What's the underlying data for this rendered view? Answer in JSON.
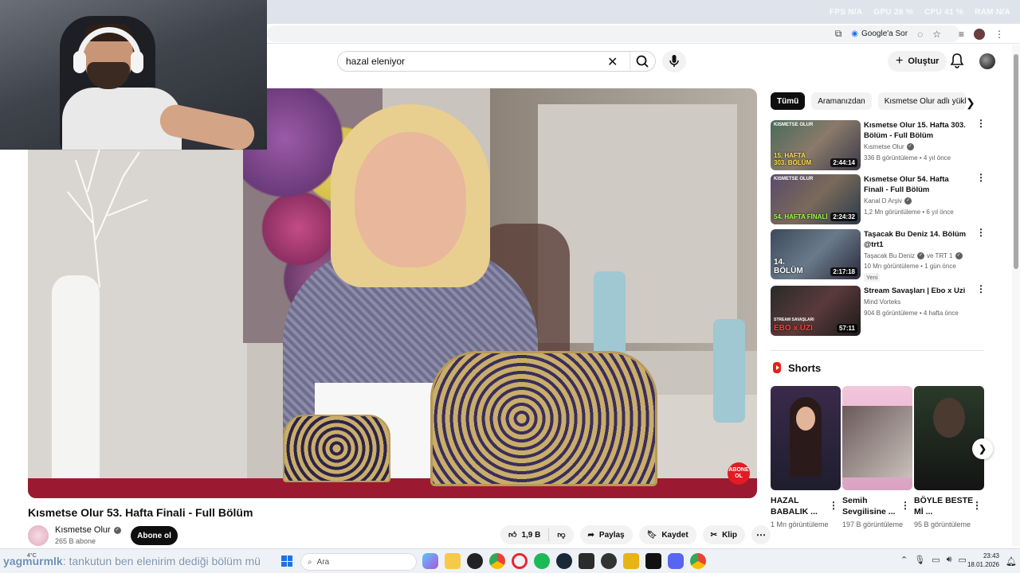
{
  "overlay": {
    "fps": "FPS N/A",
    "gpu": "GPU 26 %",
    "cpu": "CPU 41 %",
    "ram": "RAM N/A"
  },
  "browser": {
    "ask_google": "Google'a Sor"
  },
  "header": {
    "search_value": "hazal eleniyor",
    "create_label": "Oluştur"
  },
  "video": {
    "title": "Kısmetse Olur 53. Hafta Finali - Full Bölüm",
    "channel": "Kısmetse Olur",
    "subscribers": "265 B abone",
    "subscribe_label": "Abone ol",
    "likes": "1,9 B",
    "share_label": "Paylaş",
    "save_label": "Kaydet",
    "clip_label": "Klip",
    "abone_badge": "ABONE OL"
  },
  "sidebar": {
    "chips": [
      "Tümü",
      "Aramanızdan",
      "Kısmetse Olur adlı yükle"
    ],
    "recommendations": [
      {
        "title": "Kısmetse Olur 15. Hafta 303. Bölüm - Full Bölüm",
        "channel": "Kısmetse Olur",
        "meta": "336 B görüntüleme • 4 yıl önce",
        "duration": "2:44:14",
        "thumb_label": "15. HAFTA 303. BÖLÜM",
        "thumb_brand": "KISMETSE OLUR"
      },
      {
        "title": "Kısmetse Olur 54. Hafta Finali - Full Bölüm",
        "channel": "Kanal D Arşiv",
        "meta": "1,2 Mn görüntüleme • 6 yıl önce",
        "duration": "2:24:32",
        "thumb_label": "54. HAFTA FİNALİ",
        "thumb_brand": "KISMETSE OLUR"
      },
      {
        "title": "Taşacak Bu Deniz 14. Bölüm @trt1",
        "channel": "Taşacak Bu Deniz",
        "channel_extra": "ve TRT 1",
        "meta": "10 Mn görüntüleme • 1 gün önce",
        "badge": "Yeni",
        "duration": "2:17:18",
        "thumb_label": "14. BÖLÜM"
      },
      {
        "title": "Stream Savaşları | Ebo x Uzi",
        "channel": "Mind Vorteks",
        "meta": "904 B görüntüleme • 4 hafta önce",
        "duration": "57:11",
        "thumb_label": "EBO x UZI",
        "thumb_brand": "STREAM SAVAŞLARI"
      }
    ],
    "shorts_heading": "Shorts",
    "shorts": [
      {
        "title": "HAZAL BABALIK ...",
        "views": "1 Mn görüntüleme"
      },
      {
        "title": "Semih Sevgilisine ...",
        "views": "197 B görüntüleme"
      },
      {
        "title": "BÖYLE BESTE Mİ ...",
        "views": "95 B görüntüleme"
      }
    ]
  },
  "taskbar": {
    "search_placeholder": "Ara",
    "weather": "4°C",
    "time": "23:43",
    "date": "18.01.2026"
  },
  "chat": {
    "user": "yagmurmlk",
    "message": ": tankutun ben elenirim dediği bölüm mü"
  }
}
